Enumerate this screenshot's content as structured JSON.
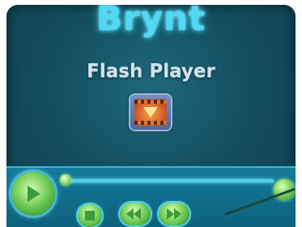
{
  "app": {
    "brand": "Brynt",
    "subtitle": "Flash Player"
  },
  "video": {
    "placeholder_icon": "film-strip-icon"
  },
  "controls": {
    "play_icon": "play-icon",
    "stop_icon": "stop-icon",
    "prev_icon": "previous-icon",
    "next_icon": "next-icon",
    "seek_icon": "seek-handle",
    "volume_icon": "volume-knob"
  },
  "colors": {
    "background": "#134f61",
    "accent": "#4fd9f5",
    "button": "#62c24a"
  }
}
